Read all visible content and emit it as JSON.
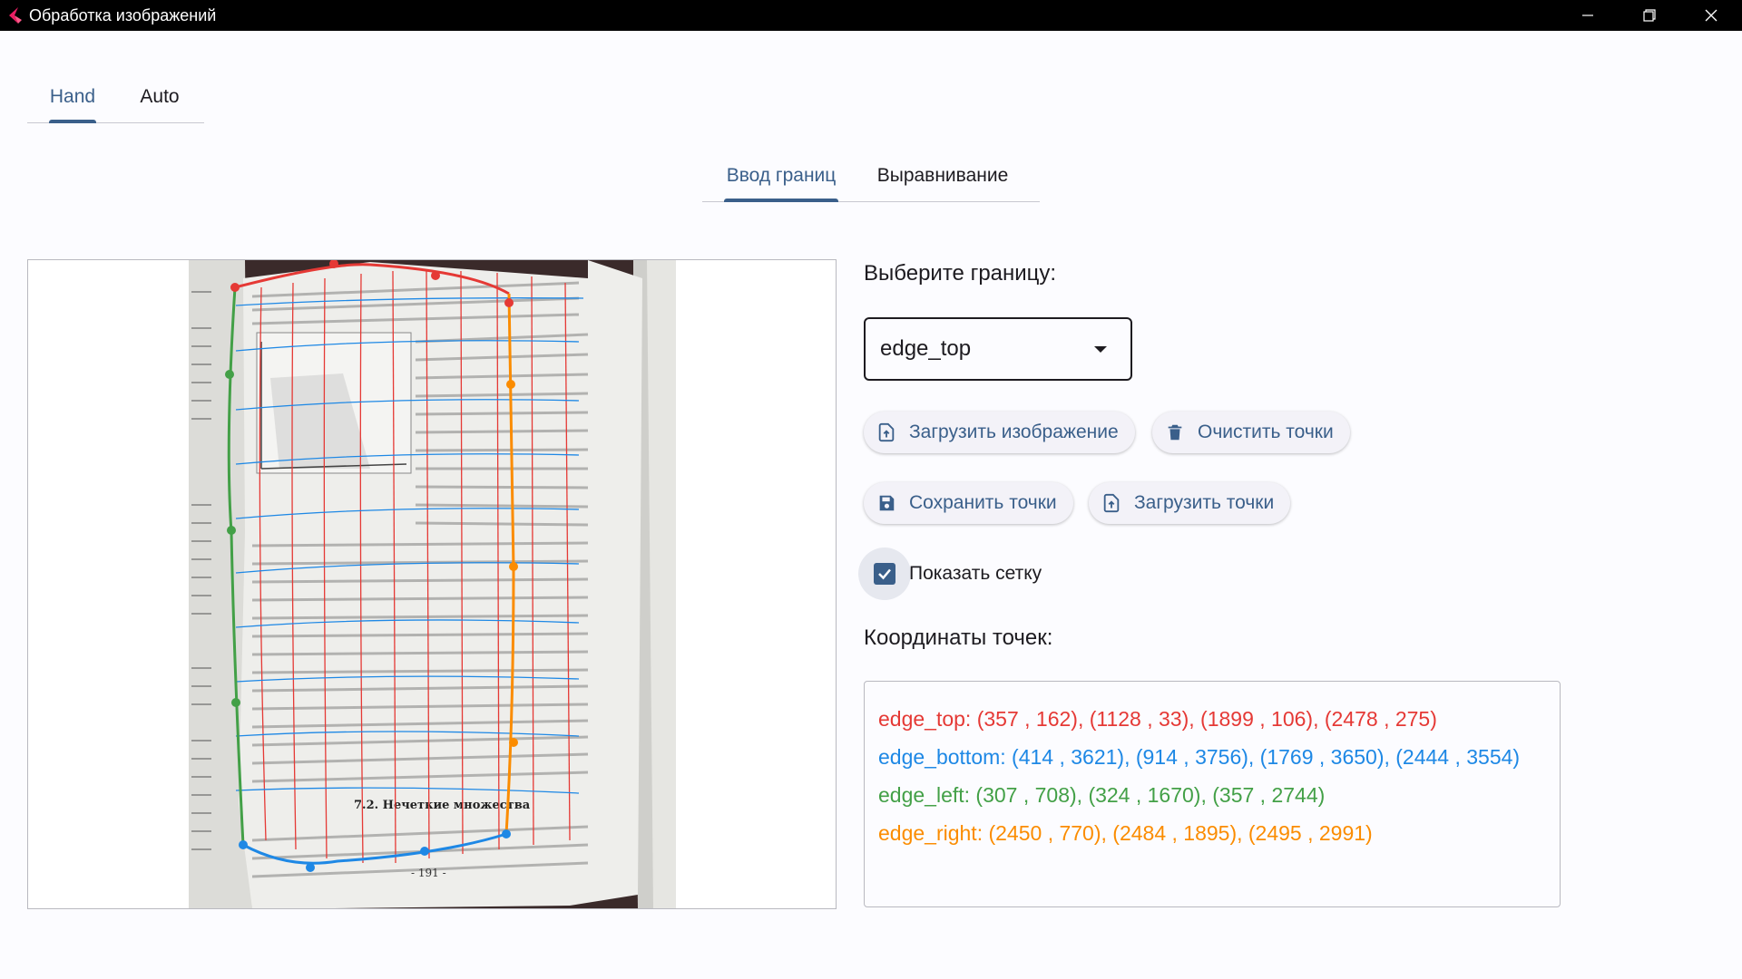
{
  "window": {
    "title": "Обработка изображений"
  },
  "top_tabs": [
    {
      "label": "Hand",
      "active": true
    },
    {
      "label": "Auto",
      "active": false
    }
  ],
  "sub_tabs": [
    {
      "label": "Ввод границ",
      "active": true
    },
    {
      "label": "Выравнивание",
      "active": false
    }
  ],
  "image_panel": {
    "page_number": "- 191 -",
    "heading": "7.2. Нечеткие множества"
  },
  "controls": {
    "select_label": "Выберите границу:",
    "selected_edge": "edge_top",
    "buttons": {
      "load_image": "Загрузить изображение",
      "clear_points": "Очистить точки",
      "save_points": "Сохранить точки",
      "load_points": "Загрузить точки"
    },
    "show_grid_label": "Показать сетку",
    "show_grid_checked": true,
    "coords_label": "Координаты точек:",
    "coords": [
      {
        "text": "edge_top: (357 , 162), (1128 , 33), (1899 , 106), (2478 , 275)",
        "color": "#e53935"
      },
      {
        "text": "edge_bottom: (414 , 3621), (914 , 3756), (1769 , 3650), (2444 , 3554)",
        "color": "#1e88e5"
      },
      {
        "text": "edge_left: (307 , 708), (324 , 1670), (357 , 2744)",
        "color": "#43a047"
      },
      {
        "text": "edge_right: (2450 , 770), (2484 , 1895), (2495 , 2991)",
        "color": "#fb8c00"
      }
    ]
  },
  "colors": {
    "accent": "#3a5f8a",
    "edge_top": "#e53935",
    "edge_bottom": "#1e88e5",
    "edge_left": "#43a047",
    "edge_right": "#fb8c00"
  },
  "icons": [
    "app-logo-icon",
    "minimize-icon",
    "restore-icon",
    "close-icon",
    "upload-file-icon",
    "trash-icon",
    "save-icon",
    "checkmark-icon"
  ]
}
